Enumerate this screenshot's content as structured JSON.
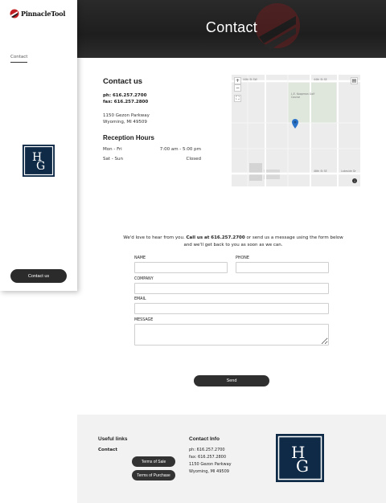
{
  "brand": {
    "logo_text": "PinnacleTool",
    "accent": "#c21f24"
  },
  "sidebar": {
    "nav_items": [
      {
        "label": "Contact"
      }
    ],
    "contact_button": "Contact us",
    "badge_letters": "HG"
  },
  "hero": {
    "title": "Contact"
  },
  "contact": {
    "title": "Contact us",
    "phone": "ph: 616.257.2700",
    "fax": "fax: 616.257.2800",
    "address_line1": "1150 Gezon Parkway",
    "address_line2": "Wyoming, MI 49509",
    "hours_title": "Reception Hours",
    "hours": [
      {
        "day": "Mon - Fri",
        "time": "7:00 am - 5:00 pm"
      },
      {
        "day": "Sat - Sun",
        "time": "Closed"
      }
    ]
  },
  "map": {
    "labels": {
      "top_left": "44th St SW",
      "top_right": "44th St SE",
      "park": "L.E. Koopman Golf Course",
      "road1": "Burlingame Ave SW",
      "road2": "Division Ave S",
      "bottom": "48th St SE",
      "left": "Byron Center Ave SW",
      "bottom_right": "Lakeside Dr"
    }
  },
  "form": {
    "intro_part1": "We'd love to hear from you. ",
    "intro_bold": "Call us at 616.257.2700",
    "intro_part2": " or send us a message using the form below and we'll get back to you as soon as we can.",
    "name_label": "NAME",
    "phone_label": "PHONE",
    "company_label": "COMPANY",
    "email_label": "EMAIL",
    "message_label": "MESSAGE",
    "send_label": "Send"
  },
  "footer": {
    "useful_links_title": "Useful links",
    "useful_links": [
      {
        "label": "Contact"
      }
    ],
    "terms_sale": "Terms of Sale",
    "terms_purchase": "Terms of Purchase",
    "contact_title": "Contact Info",
    "phone": "ph: 616.257.2700",
    "fax": "fax: 616.257.2800",
    "address_line1": "1150 Gezon Parkway",
    "address_line2": "Wyoming, MI 49509"
  }
}
